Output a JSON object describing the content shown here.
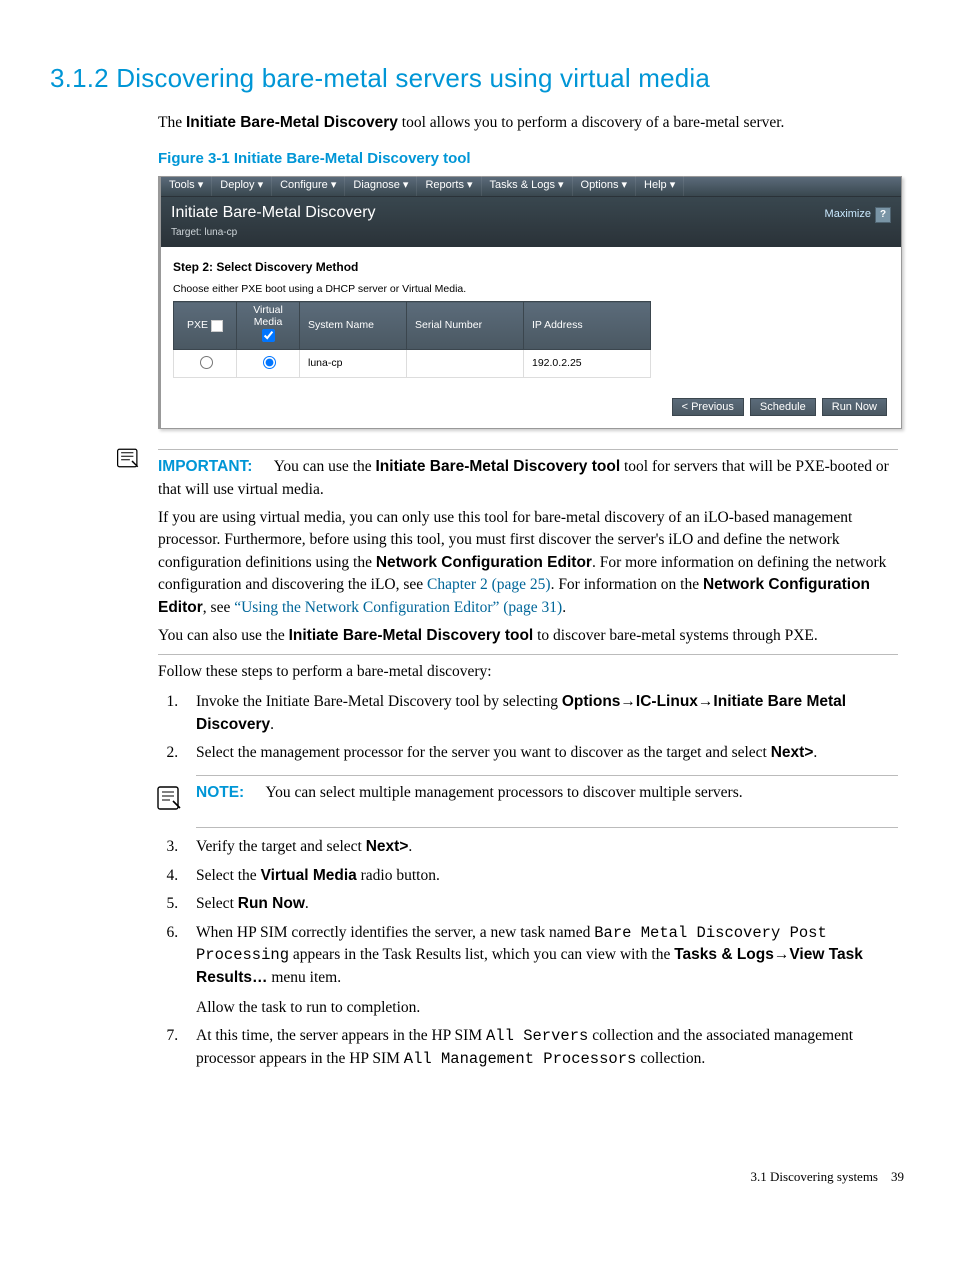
{
  "heading": "3.1.2 Discovering bare-metal servers using virtual media",
  "intro_a": "The ",
  "intro_bold": "Initiate Bare-Metal Discovery",
  "intro_b": " tool allows you to perform a discovery of a bare-metal server.",
  "figure_caption": "Figure 3-1 Initiate Bare-Metal Discovery tool",
  "ui": {
    "menubar": [
      "Tools ▾",
      "Deploy ▾",
      "Configure ▾",
      "Diagnose ▾",
      "Reports ▾",
      "Tasks & Logs ▾",
      "Options ▾",
      "Help ▾"
    ],
    "title": "Initiate Bare-Metal Discovery",
    "target": "Target: luna-cp",
    "maximize": "Maximize",
    "help_q": "?",
    "step_heading": "Step 2: Select Discovery Method",
    "instruction": "Choose either PXE boot using a DHCP server or Virtual Media.",
    "headers": {
      "pxe": "PXE",
      "vm_line1": "Virtual",
      "vm_line2": "Media",
      "sys": "System Name",
      "serial": "Serial Number",
      "ip": "IP Address"
    },
    "row": {
      "system": "luna-cp",
      "serial": "",
      "ip": "192.0.2.25"
    },
    "buttons": {
      "prev": "< Previous",
      "sched": "Schedule",
      "run": "Run Now"
    }
  },
  "important": {
    "label": "IMPORTANT:",
    "p1a": "You can use the ",
    "p1bold": "Initiate Bare-Metal Discovery tool",
    "p1b": " tool for servers that will be PXE-booted or that will use virtual media.",
    "p2a": "If you are using virtual media, you can only use this tool for bare-metal discovery of an iLO-based management processor. Furthermore, before using this tool, you must first discover the server's iLO and define the network configuration definitions using the ",
    "p2bold": "Network Configuration Editor",
    "p2b": ". For more information on defining the network configuration and discovering the iLO, see ",
    "p2link1": "Chapter 2 (page 25)",
    "p2c": ". For information on the ",
    "p2bold2": "Network Configuration Editor",
    "p2d": ", see ",
    "p2link2": "“Using the Network Configuration Editor” (page 31)",
    "p2e": ".",
    "p3a": "You can also use the ",
    "p3bold": "Initiate Bare-Metal Discovery tool",
    "p3b": " to discover bare-metal systems through PXE."
  },
  "steps_intro": "Follow these steps to perform a bare-metal discovery:",
  "steps": {
    "s1a": "Invoke the Initiate Bare-Metal Discovery tool by selecting ",
    "s1_o": "Options",
    "s1_ic": "IC-Linux",
    "s1_b": "Initiate Bare Metal Discovery",
    "arrow": "→",
    "period": ".",
    "s2a": "Select the management processor for the server you want to discover as the target and select ",
    "s2_next": "Next>",
    "s3a": "Verify the target and select ",
    "s3_next": "Next>",
    "s4a": "Select the ",
    "s4_vm": "Virtual Media",
    "s4b": " radio button.",
    "s5a": "Select ",
    "s5_run": "Run Now",
    "s6a": "When HP SIM correctly identifies the server, a new task named ",
    "s6_m1": "Bare Metal Discovery Post Processing",
    "s6b": " appears in the Task Results list, which you can view with the ",
    "s6_bold1": "Tasks & Logs",
    "s6_bold2": "View Task Results…",
    "s6c": " menu item.",
    "s6p2": "Allow the task to run to completion.",
    "s7a": "At this time, the server appears in the HP SIM ",
    "s7_m1": "All Servers",
    "s7b": " collection and the associated management processor appears in the HP SIM ",
    "s7_m2": "All Management Processors",
    "s7c": " collection."
  },
  "note": {
    "label": "NOTE:",
    "text": "You can select multiple management processors to discover multiple servers."
  },
  "footer_a": "3.1 Discovering systems",
  "footer_b": "39"
}
